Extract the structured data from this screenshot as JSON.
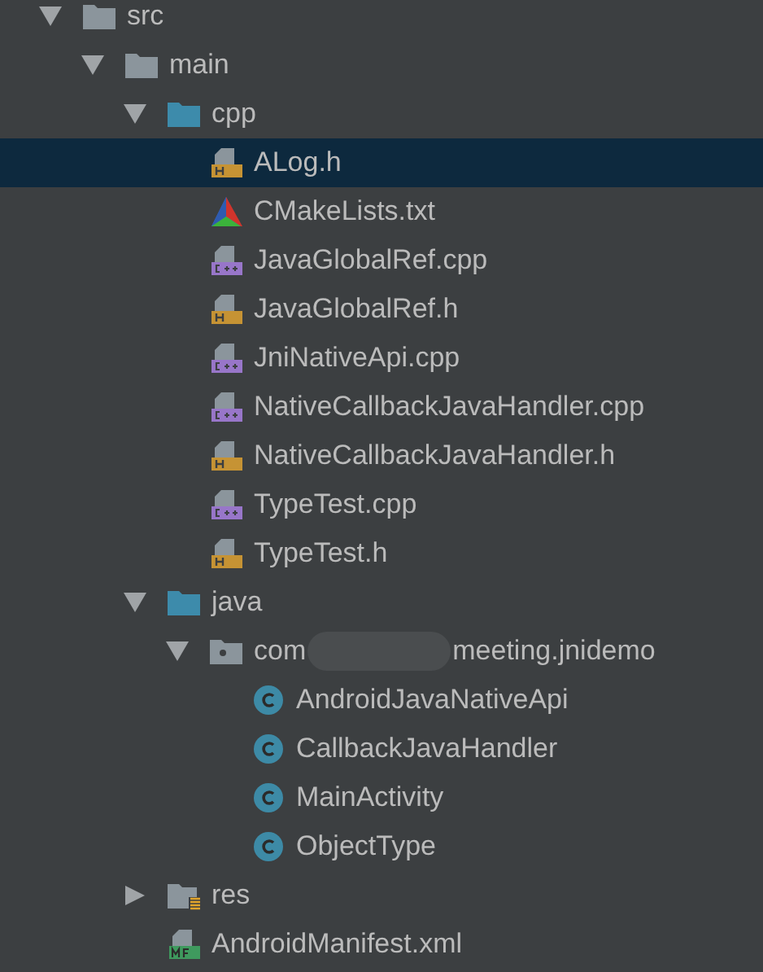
{
  "tree": [
    {
      "label": "src",
      "kind": "folder",
      "expanded": true,
      "selected": false,
      "children": [
        {
          "label": "main",
          "kind": "folder",
          "expanded": true,
          "selected": false,
          "children": [
            {
              "label": "cpp",
              "kind": "source-folder",
              "expanded": true,
              "selected": false,
              "children": [
                {
                  "label": "ALog.h",
                  "kind": "header",
                  "selected": true
                },
                {
                  "label": "CMakeLists.txt",
                  "kind": "cmake",
                  "selected": false
                },
                {
                  "label": "JavaGlobalRef.cpp",
                  "kind": "cpp",
                  "selected": false
                },
                {
                  "label": "JavaGlobalRef.h",
                  "kind": "header",
                  "selected": false
                },
                {
                  "label": "JniNativeApi.cpp",
                  "kind": "cpp",
                  "selected": false
                },
                {
                  "label": "NativeCallbackJavaHandler.cpp",
                  "kind": "cpp",
                  "selected": false
                },
                {
                  "label": "NativeCallbackJavaHandler.h",
                  "kind": "header",
                  "selected": false
                },
                {
                  "label": "TypeTest.cpp",
                  "kind": "cpp",
                  "selected": false
                },
                {
                  "label": "TypeTest.h",
                  "kind": "header",
                  "selected": false
                }
              ]
            },
            {
              "label": "java",
              "kind": "source-folder",
              "expanded": true,
              "selected": false,
              "children": [
                {
                  "label": "com",
                  "label_end": "meeting.jnidemo",
                  "kind": "package",
                  "expanded": true,
                  "selected": false,
                  "children": [
                    {
                      "label": "AndroidJavaNativeApi",
                      "kind": "class",
                      "selected": false
                    },
                    {
                      "label": "CallbackJavaHandler",
                      "kind": "class",
                      "selected": false
                    },
                    {
                      "label": "MainActivity",
                      "kind": "class",
                      "selected": false
                    },
                    {
                      "label": "ObjectType",
                      "kind": "class",
                      "selected": false
                    }
                  ]
                }
              ]
            },
            {
              "label": "res",
              "kind": "res-folder",
              "expanded": false,
              "selected": false
            },
            {
              "label": "AndroidManifest.xml",
              "kind": "manifest",
              "selected": false
            }
          ]
        }
      ]
    }
  ]
}
